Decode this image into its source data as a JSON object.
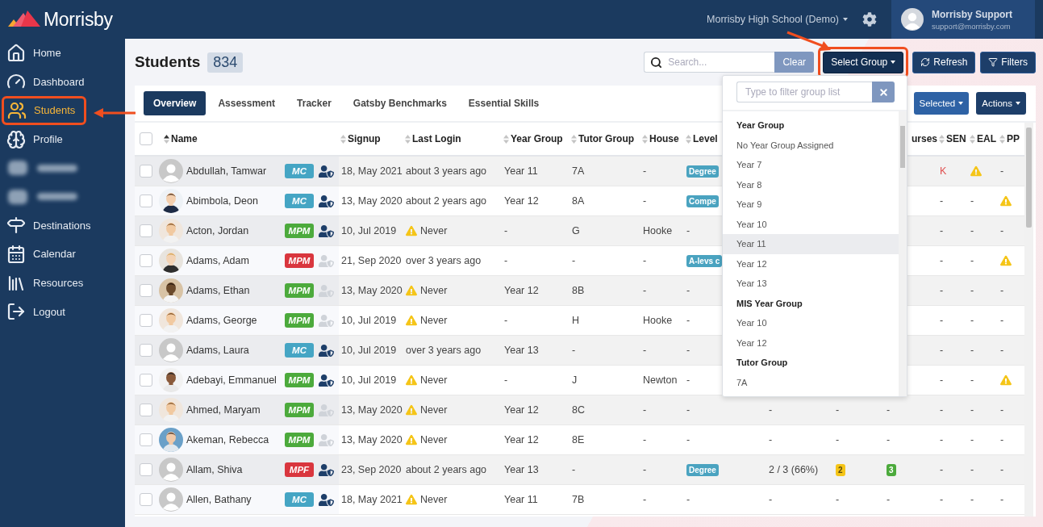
{
  "sidebar": {
    "logo": "Morrisby",
    "items": [
      {
        "kind": "link",
        "label": "Home",
        "selected": false,
        "highlighted": false
      },
      {
        "kind": "link",
        "label": "Dashboard",
        "selected": false,
        "highlighted": false
      },
      {
        "kind": "link",
        "label": "Students",
        "selected": true,
        "highlighted": true
      },
      {
        "kind": "link",
        "label": "Profile",
        "selected": false,
        "highlighted": false
      },
      {
        "kind": "blurred"
      },
      {
        "kind": "blurred"
      },
      {
        "kind": "link",
        "label": "Destinations",
        "selected": false,
        "highlighted": false
      },
      {
        "kind": "link",
        "label": "Calendar",
        "selected": false,
        "highlighted": false
      },
      {
        "kind": "link",
        "label": "Resources",
        "selected": false,
        "highlighted": false
      },
      {
        "kind": "link",
        "label": "Logout",
        "selected": false,
        "highlighted": false
      }
    ]
  },
  "top_bar": {
    "school": "Morrisby High School (Demo)",
    "user_name": "Morrisby Support",
    "user_email": "support@morrisby.com"
  },
  "header": {
    "title": "Students",
    "count": "834",
    "search": {
      "placeholder": "Search..."
    },
    "buttons": [
      {
        "kind": "clear",
        "label": "Clear",
        "highlighted": false
      },
      {
        "kind": "dropdown",
        "label": "Select Group",
        "highlighted": true
      },
      {
        "kind": "refresh",
        "label": "Refresh",
        "highlighted": false
      },
      {
        "kind": "filter",
        "label": "Filters",
        "highlighted": false
      }
    ]
  },
  "tabs": [
    {
      "label": "Overview",
      "selected": true
    },
    {
      "label": "Assessment",
      "selected": false
    },
    {
      "label": "Tracker",
      "selected": false
    },
    {
      "label": "Gatsby Benchmarks",
      "selected": false
    },
    {
      "label": "Essential Skills",
      "selected": false
    }
  ],
  "table_actions": [
    {
      "kind": "secondary",
      "label": "Selected"
    },
    {
      "kind": "primary",
      "label": "Actions"
    }
  ],
  "group_dropdown": {
    "filter": {
      "placeholder": "Type to filter group list"
    },
    "sections": [
      {
        "title": "Year Group",
        "items": [
          {
            "label": "No Year Group Assigned",
            "selected": false
          },
          {
            "label": "Year 7",
            "selected": false
          },
          {
            "label": "Year 8",
            "selected": false
          },
          {
            "label": "Year 9",
            "selected": false
          },
          {
            "label": "Year 10",
            "selected": false
          },
          {
            "label": "Year 11",
            "selected": true
          },
          {
            "label": "Year 12",
            "selected": false
          },
          {
            "label": "Year 13",
            "selected": false
          }
        ]
      },
      {
        "title": "MIS Year Group",
        "items": [
          {
            "label": "Year 10",
            "selected": false
          },
          {
            "label": "Year 12",
            "selected": false
          }
        ]
      },
      {
        "title": "Tutor Group",
        "items": [
          {
            "label": "7A",
            "selected": false
          }
        ]
      }
    ]
  },
  "table": {
    "select_all": {
      "checked": false
    },
    "columns": [
      {
        "label": "Name",
        "sorted": true
      },
      {
        "label": "Signup",
        "sorted": false
      },
      {
        "label": "Last Login",
        "sorted": false
      },
      {
        "label": "Year Group",
        "sorted": false
      },
      {
        "label": "Tutor Group",
        "sorted": false
      },
      {
        "label": "House",
        "sorted": false
      },
      {
        "label": "Level",
        "sorted": false
      },
      null,
      null,
      {
        "label": "urses"
      },
      {
        "label": "SEN",
        "sorted": false
      },
      {
        "label": "EAL",
        "sorted": false
      },
      {
        "label": "PP",
        "sorted": false
      }
    ],
    "rows": [
      {
        "checked": false,
        "cells": [
          {
            "kind": "student",
            "photo": false,
            "name": "Abdullah, Tamwar",
            "badge": {
              "text": "MC",
              "color": "#45a5c4"
            },
            "linked": true
          },
          {
            "kind": "text",
            "text": "18, May 2021"
          },
          {
            "kind": "text",
            "text": "about 3 years ago"
          },
          {
            "kind": "text",
            "text": "Year 11"
          },
          {
            "kind": "text",
            "text": "7A"
          },
          {
            "kind": "text",
            "text": "-"
          },
          {
            "kind": "tag",
            "text": "Degree",
            "color": "#4aa3c0"
          },
          null,
          null,
          null,
          {
            "kind": "text",
            "text": "K",
            "color": "#e05050"
          },
          {
            "kind": "warning"
          },
          {
            "kind": "text",
            "text": "-"
          }
        ]
      },
      {
        "checked": false,
        "cells": [
          {
            "kind": "student",
            "photo": true,
            "name": "Abimbola, Deon",
            "badge": {
              "text": "MC",
              "color": "#45a5c4"
            },
            "linked": true
          },
          {
            "kind": "text",
            "text": "13, May 2020"
          },
          {
            "kind": "text",
            "text": "about 2 years ago"
          },
          {
            "kind": "text",
            "text": "Year 12"
          },
          {
            "kind": "text",
            "text": "8A"
          },
          {
            "kind": "text",
            "text": "-"
          },
          {
            "kind": "tag",
            "text": "Compe",
            "color": "#4aa3c0"
          },
          null,
          null,
          null,
          {
            "kind": "text",
            "text": "-"
          },
          {
            "kind": "text",
            "text": "-"
          },
          {
            "kind": "warning"
          }
        ]
      },
      {
        "checked": false,
        "cells": [
          {
            "kind": "student",
            "photo": true,
            "name": "Acton, Jordan",
            "badge": {
              "text": "MPM",
              "color": "#4caa3c"
            },
            "linked": true
          },
          {
            "kind": "text",
            "text": "10, Jul 2019"
          },
          {
            "kind": "warning",
            "text": "Never"
          },
          {
            "kind": "text",
            "text": "-"
          },
          {
            "kind": "text",
            "text": "G"
          },
          {
            "kind": "text",
            "text": "Hooke"
          },
          {
            "kind": "text",
            "text": "-"
          },
          null,
          null,
          null,
          {
            "kind": "text",
            "text": "-"
          },
          {
            "kind": "text",
            "text": "-"
          },
          {
            "kind": "text",
            "text": "-"
          }
        ]
      },
      {
        "checked": false,
        "cells": [
          {
            "kind": "student",
            "photo": true,
            "name": "Adams, Adam",
            "badge": {
              "text": "MPM",
              "color": "#d9363e"
            },
            "linked": false
          },
          {
            "kind": "text",
            "text": "21, Sep 2020"
          },
          {
            "kind": "text",
            "text": "over 3 years ago"
          },
          {
            "kind": "text",
            "text": "-"
          },
          {
            "kind": "text",
            "text": "-"
          },
          {
            "kind": "text",
            "text": "-"
          },
          {
            "kind": "tag",
            "text": "A-levs c",
            "color": "#4aa3c0"
          },
          null,
          null,
          null,
          {
            "kind": "text",
            "text": "-"
          },
          {
            "kind": "text",
            "text": "-"
          },
          {
            "kind": "warning"
          }
        ]
      },
      {
        "checked": false,
        "cells": [
          {
            "kind": "student",
            "photo": true,
            "name": "Adams, Ethan",
            "badge": {
              "text": "MPM",
              "color": "#4caa3c"
            },
            "linked": false
          },
          {
            "kind": "text",
            "text": "13, May 2020"
          },
          {
            "kind": "warning",
            "text": "Never"
          },
          {
            "kind": "text",
            "text": "Year 12"
          },
          {
            "kind": "text",
            "text": "8B"
          },
          {
            "kind": "text",
            "text": "-"
          },
          {
            "kind": "text",
            "text": "-"
          },
          null,
          null,
          null,
          {
            "kind": "text",
            "text": "-"
          },
          {
            "kind": "text",
            "text": "-"
          },
          {
            "kind": "text",
            "text": "-"
          }
        ]
      },
      {
        "checked": false,
        "cells": [
          {
            "kind": "student",
            "photo": true,
            "name": "Adams, George",
            "badge": {
              "text": "MPM",
              "color": "#4caa3c"
            },
            "linked": false
          },
          {
            "kind": "text",
            "text": "10, Jul 2019"
          },
          {
            "kind": "warning",
            "text": "Never"
          },
          {
            "kind": "text",
            "text": "-"
          },
          {
            "kind": "text",
            "text": "H"
          },
          {
            "kind": "text",
            "text": "Hooke"
          },
          {
            "kind": "text",
            "text": "-"
          },
          null,
          null,
          null,
          {
            "kind": "text",
            "text": "-"
          },
          {
            "kind": "text",
            "text": "-"
          },
          {
            "kind": "text",
            "text": "-"
          }
        ]
      },
      {
        "checked": false,
        "cells": [
          {
            "kind": "student",
            "photo": false,
            "name": "Adams, Laura",
            "badge": {
              "text": "MC",
              "color": "#45a5c4"
            },
            "linked": true
          },
          {
            "kind": "text",
            "text": "10, Jul 2019"
          },
          {
            "kind": "text",
            "text": "over 3 years ago"
          },
          {
            "kind": "text",
            "text": "Year 13"
          },
          {
            "kind": "text",
            "text": "-"
          },
          {
            "kind": "text",
            "text": "-"
          },
          {
            "kind": "text",
            "text": "-"
          },
          null,
          null,
          null,
          {
            "kind": "text",
            "text": "-"
          },
          {
            "kind": "text",
            "text": "-"
          },
          {
            "kind": "text",
            "text": "-"
          }
        ]
      },
      {
        "checked": false,
        "cells": [
          {
            "kind": "student",
            "photo": true,
            "name": "Adebayi, Emmanuel",
            "badge": {
              "text": "MPM",
              "color": "#4caa3c"
            },
            "linked": true
          },
          {
            "kind": "text",
            "text": "10, Jul 2019"
          },
          {
            "kind": "warning",
            "text": "Never"
          },
          {
            "kind": "text",
            "text": "-"
          },
          {
            "kind": "text",
            "text": "J"
          },
          {
            "kind": "text",
            "text": "Newton"
          },
          {
            "kind": "text",
            "text": "-"
          },
          null,
          null,
          null,
          {
            "kind": "text",
            "text": "-"
          },
          {
            "kind": "text",
            "text": "-"
          },
          {
            "kind": "warning"
          }
        ]
      },
      {
        "checked": false,
        "cells": [
          {
            "kind": "student",
            "photo": true,
            "name": "Ahmed, Maryam",
            "badge": {
              "text": "MPM",
              "color": "#4caa3c"
            },
            "linked": false
          },
          {
            "kind": "text",
            "text": "13, May 2020"
          },
          {
            "kind": "warning",
            "text": "Never"
          },
          {
            "kind": "text",
            "text": "Year 12"
          },
          {
            "kind": "text",
            "text": "8C"
          },
          {
            "kind": "text",
            "text": "-"
          },
          {
            "kind": "text",
            "text": "-"
          },
          {
            "kind": "text",
            "text": "-"
          },
          {
            "kind": "text",
            "text": "-"
          },
          {
            "kind": "text",
            "text": "-"
          },
          {
            "kind": "text",
            "text": "-"
          },
          {
            "kind": "text",
            "text": "-"
          },
          {
            "kind": "text",
            "text": "-"
          }
        ]
      },
      {
        "checked": false,
        "cells": [
          {
            "kind": "student",
            "photo": true,
            "name": "Akeman, Rebecca",
            "badge": {
              "text": "MPM",
              "color": "#4caa3c"
            },
            "linked": false
          },
          {
            "kind": "text",
            "text": "13, May 2020"
          },
          {
            "kind": "warning",
            "text": "Never"
          },
          {
            "kind": "text",
            "text": "Year 12"
          },
          {
            "kind": "text",
            "text": "8E"
          },
          {
            "kind": "text",
            "text": "-"
          },
          {
            "kind": "text",
            "text": "-"
          },
          {
            "kind": "text",
            "text": "-"
          },
          {
            "kind": "text",
            "text": "-"
          },
          {
            "kind": "text",
            "text": "-"
          },
          {
            "kind": "text",
            "text": "-"
          },
          {
            "kind": "text",
            "text": "-"
          },
          {
            "kind": "text",
            "text": "-"
          }
        ]
      },
      {
        "checked": false,
        "cells": [
          {
            "kind": "student",
            "photo": false,
            "name": "Allam, Shiva",
            "badge": {
              "text": "MPF",
              "color": "#d9363e"
            },
            "linked": true
          },
          {
            "kind": "text",
            "text": "23, Sep 2020"
          },
          {
            "kind": "text",
            "text": "about 2 years ago"
          },
          {
            "kind": "text",
            "text": "Year 13"
          },
          {
            "kind": "text",
            "text": "-"
          },
          {
            "kind": "text",
            "text": "-"
          },
          {
            "kind": "tag",
            "text": "Degree",
            "color": "#4aa3c0"
          },
          {
            "kind": "text",
            "text": "2 / 3 (66%)"
          },
          {
            "kind": "tag",
            "text": "2",
            "color": "#f5c518"
          },
          {
            "kind": "tag",
            "text": "3",
            "color": "#4caa3c"
          },
          {
            "kind": "text",
            "text": "-"
          },
          {
            "kind": "text",
            "text": "-"
          },
          {
            "kind": "text",
            "text": "-"
          }
        ]
      },
      {
        "checked": false,
        "cells": [
          {
            "kind": "student",
            "photo": false,
            "name": "Allen, Bathany",
            "badge": {
              "text": "MC",
              "color": "#45a5c4"
            },
            "linked": true
          },
          {
            "kind": "text",
            "text": "18, May 2021"
          },
          {
            "kind": "warning",
            "text": "Never"
          },
          {
            "kind": "text",
            "text": "Year 11"
          },
          {
            "kind": "text",
            "text": "7B"
          },
          {
            "kind": "text",
            "text": "-"
          },
          {
            "kind": "text",
            "text": "-"
          },
          {
            "kind": "text",
            "text": "-"
          },
          {
            "kind": "text",
            "text": "-"
          },
          {
            "kind": "text",
            "text": "-"
          },
          {
            "kind": "text",
            "text": "-"
          },
          {
            "kind": "text",
            "text": "-"
          },
          {
            "kind": "text",
            "text": "-"
          }
        ]
      }
    ]
  }
}
